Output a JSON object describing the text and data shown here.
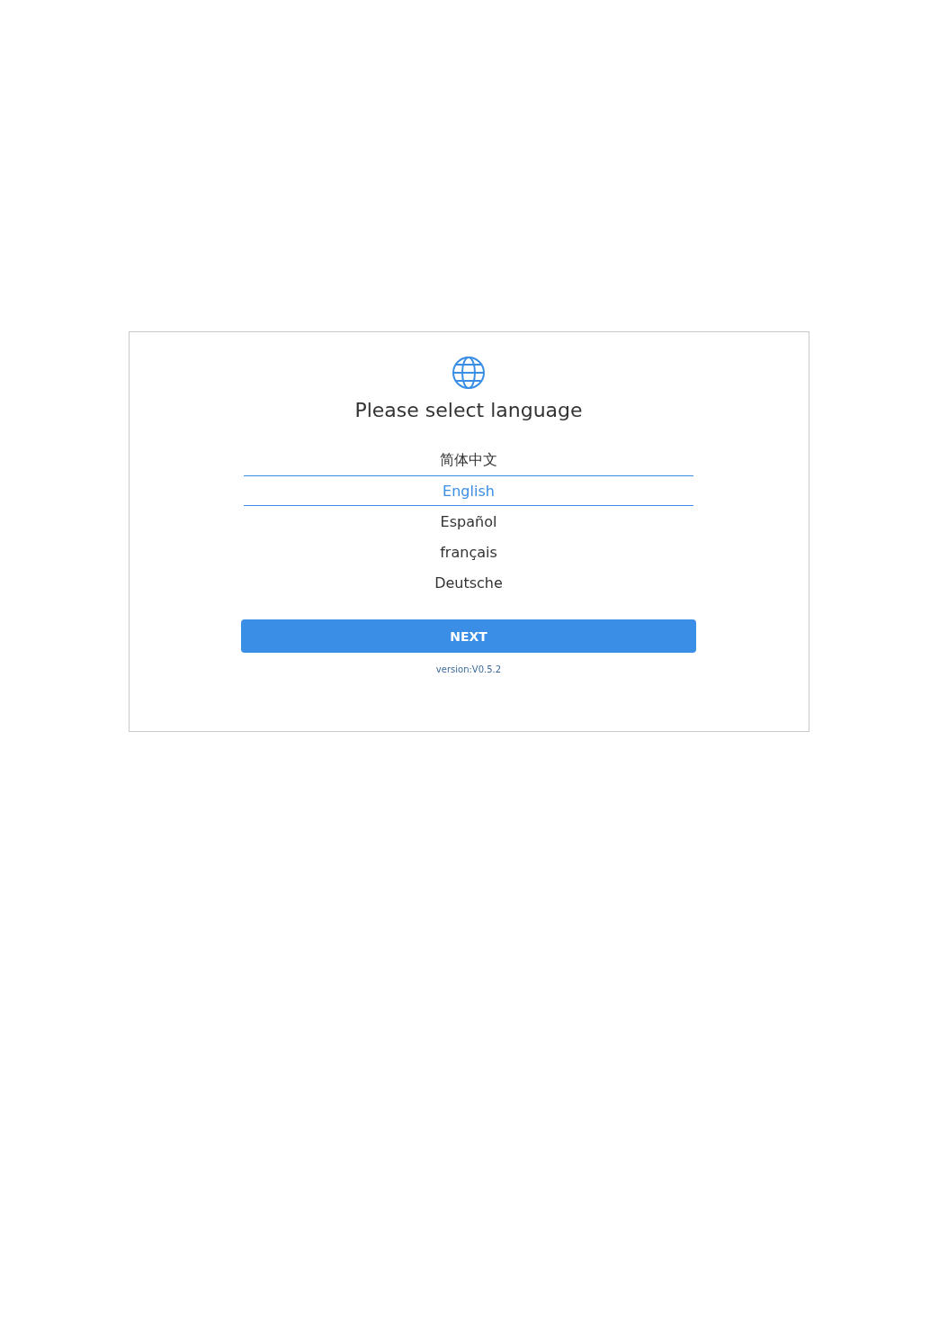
{
  "dialog": {
    "title": "Please select language",
    "languages": [
      {
        "label": "简体中文",
        "selected": false
      },
      {
        "label": "English",
        "selected": true
      },
      {
        "label": "Español",
        "selected": false
      },
      {
        "label": "français",
        "selected": false
      },
      {
        "label": "Deutsche",
        "selected": false
      }
    ],
    "next_button": "NEXT",
    "version": "version:V0.5.2"
  }
}
